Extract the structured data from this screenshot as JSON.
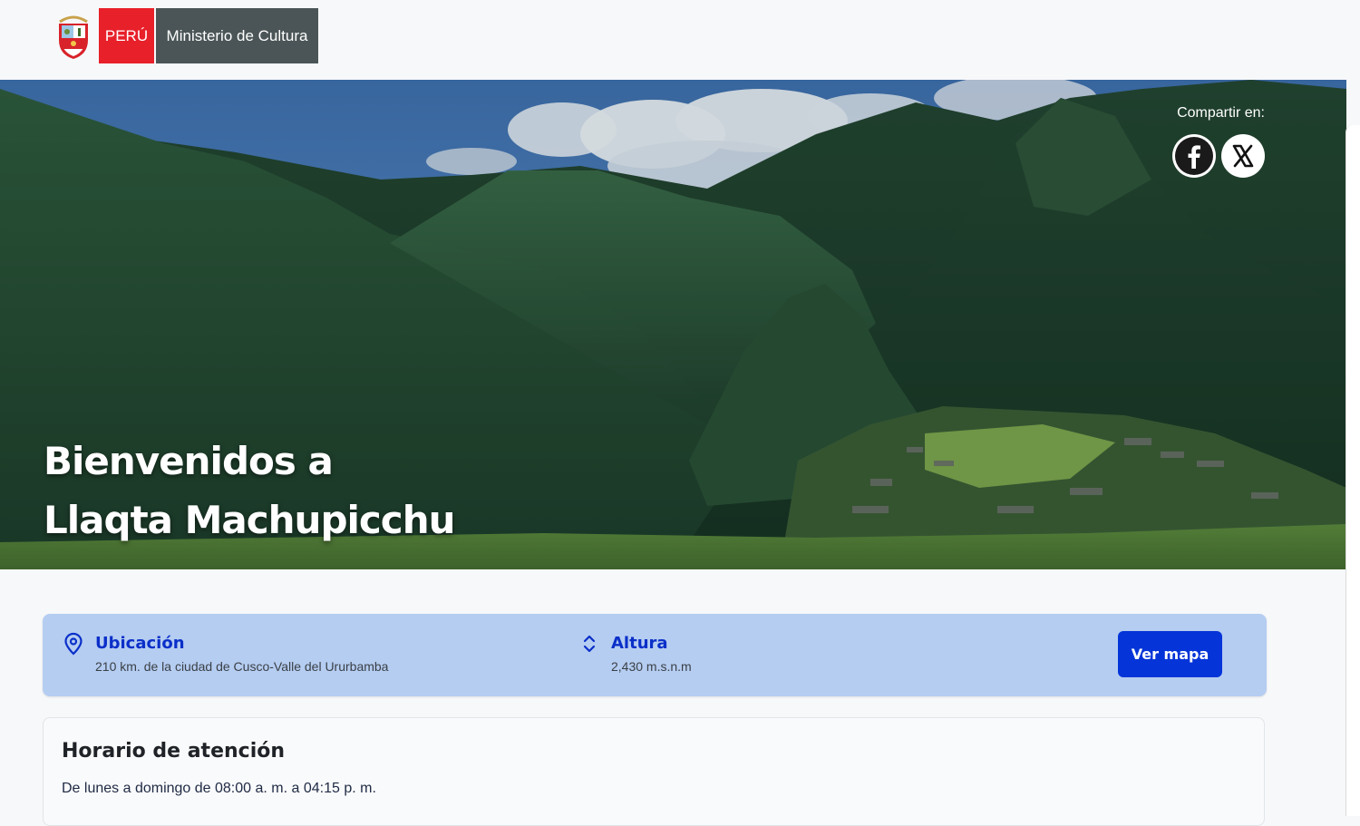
{
  "header": {
    "peru_label": "PERÚ",
    "ministry_label": "Ministerio de Cultura"
  },
  "hero": {
    "share_label": "Compartir en:",
    "share_icons": [
      "facebook-icon",
      "x-icon"
    ],
    "title_line1": "Bienvenidos a",
    "title_line2": "Llaqta Machupicchu"
  },
  "info": {
    "location_label": "Ubicación",
    "location_value": "210 km. de la ciudad de Cusco-Valle del Ururbamba",
    "altitude_label": "Altura",
    "altitude_value": "2,430 m.s.n.m",
    "map_button": "Ver mapa"
  },
  "schedule": {
    "title": "Horario de atención",
    "text": "De lunes a domingo de 08:00 a. m. a 04:15 p. m."
  },
  "colors": {
    "peru_red": "#e8202a",
    "ministry_gray": "#4b5557",
    "info_bar_bg": "#b5cdf1",
    "accent_blue": "#0535d8",
    "label_blue": "#0a2fc9"
  }
}
